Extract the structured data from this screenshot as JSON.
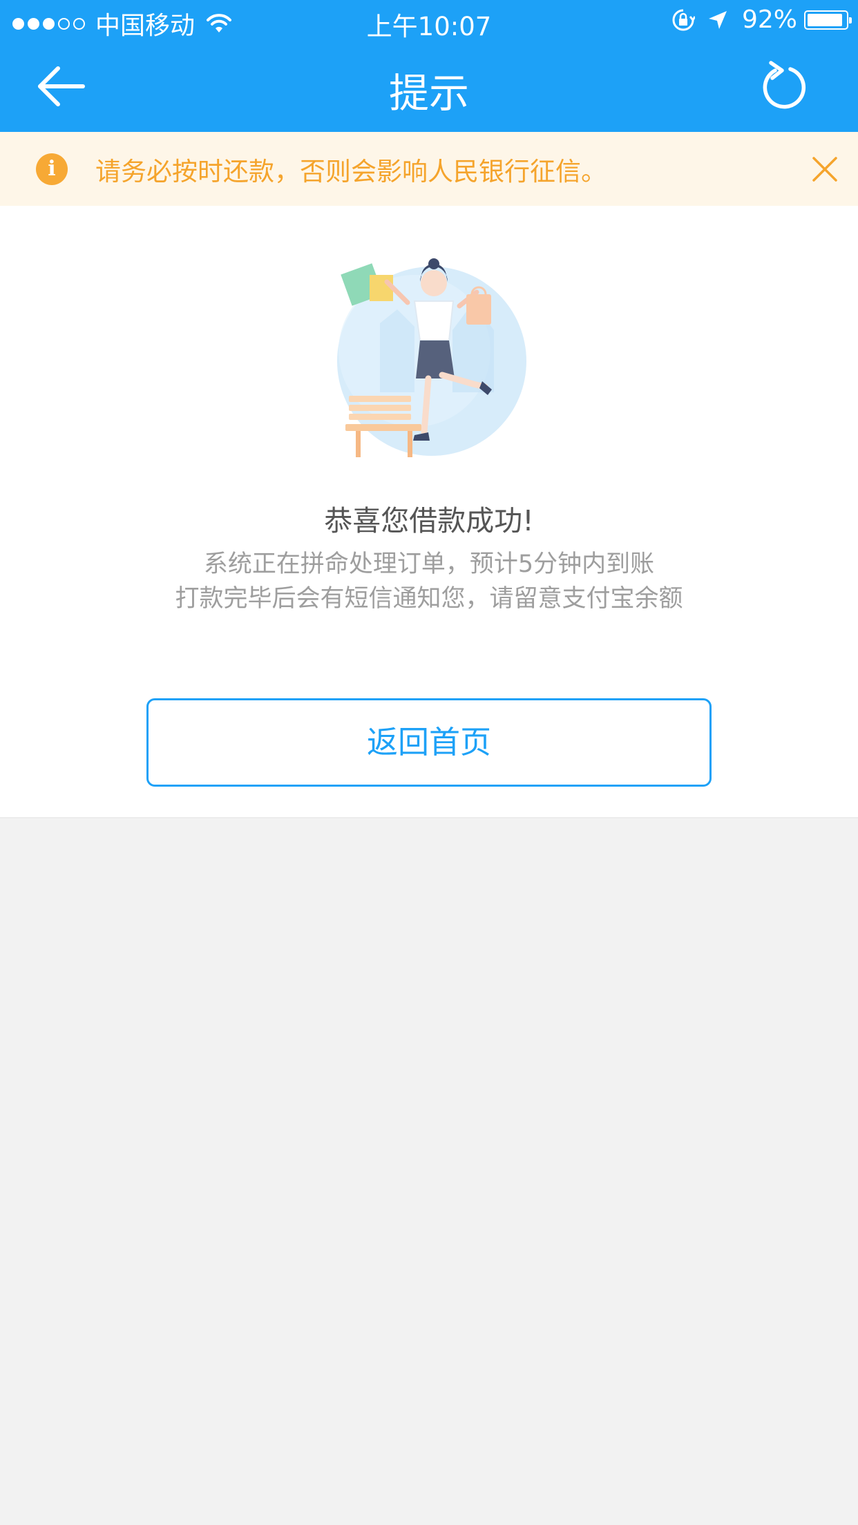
{
  "status_bar": {
    "signal_dots": [
      "on",
      "on",
      "on",
      "off",
      "off"
    ],
    "carrier": "中国移动",
    "time": "上午10:07",
    "battery_percent": "92%",
    "battery_level": 0.92,
    "icons": [
      "wifi-icon",
      "orientation-lock-icon",
      "location-arrow-icon",
      "battery-icon"
    ]
  },
  "navbar": {
    "title": "提示",
    "back_icon": "arrow-left-icon",
    "refresh_icon": "refresh-icon"
  },
  "notice": {
    "icon": "info-icon",
    "icon_glyph": "i",
    "text": "请务必按时还款，否则会影响人民银行征信。",
    "close_icon": "close-icon"
  },
  "main": {
    "title": "恭喜您借款成功!",
    "description_line1": "系统正在拼命处理订单，预计5分钟内到账",
    "description_line2": "打款完毕后会有短信通知您，请留意支付宝余额",
    "button_label": "返回首页"
  },
  "colors": {
    "primary": "#1da1f7",
    "notice_bg": "#fef6e8",
    "notice_text": "#f5a42c",
    "page_bg": "#f2f2f2"
  }
}
